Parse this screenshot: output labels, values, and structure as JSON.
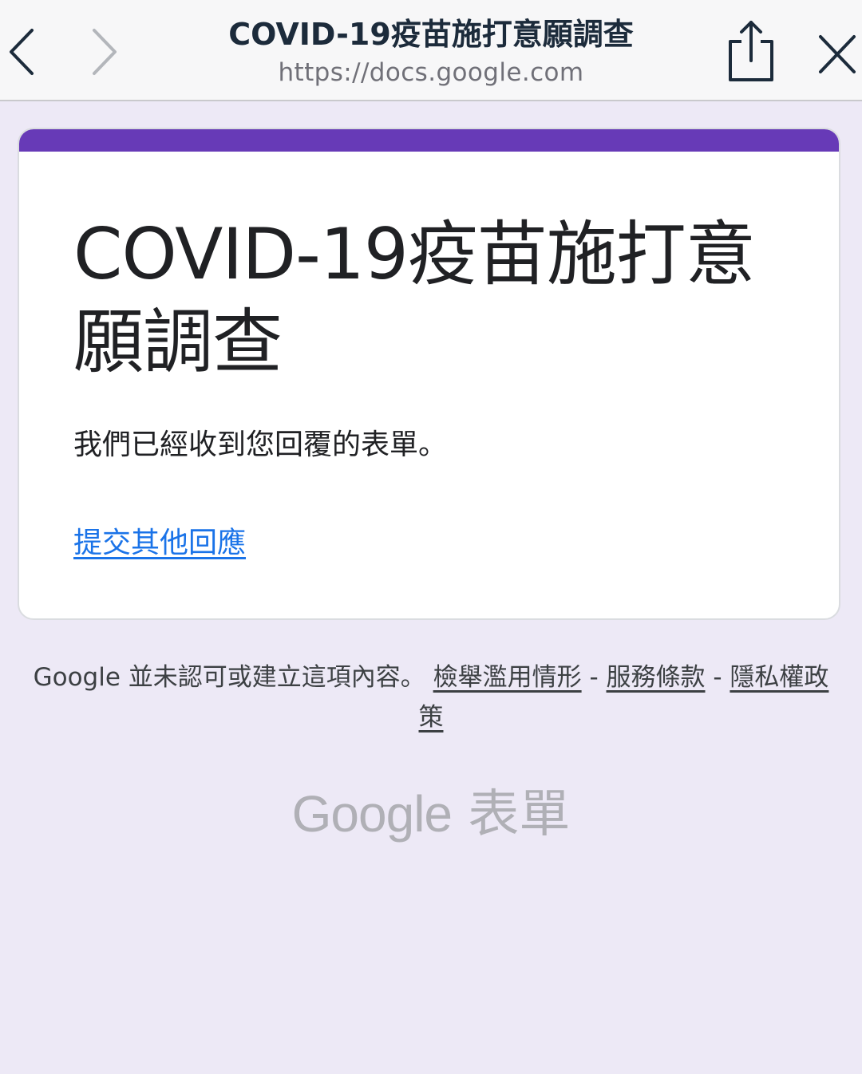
{
  "browser": {
    "title": "COVID-19疫苗施打意願調查",
    "url": "https://docs.google.com",
    "icons": {
      "back": "chevron-left-icon",
      "forward": "chevron-right-icon",
      "share": "share-icon",
      "close": "close-icon"
    }
  },
  "form": {
    "accent_color": "#673ab7",
    "title": "COVID-19疫苗施打意願調查",
    "confirmation": "我們已經收到您回覆的表單。",
    "another_response_link": "提交其他回應"
  },
  "footer": {
    "disclaimer": "Google 並未認可或建立這項內容。",
    "report_abuse": "檢舉濫用情形",
    "separator": "-",
    "terms": "服務條款",
    "privacy": "隱私權政策"
  },
  "brand": {
    "logo_word": "Google",
    "product": "表單"
  }
}
